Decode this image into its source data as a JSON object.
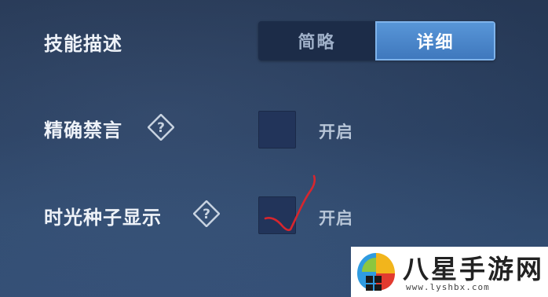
{
  "settings": {
    "skill_description": {
      "label": "技能描述",
      "options": [
        "简略",
        "详细"
      ],
      "selected": "详细"
    },
    "accurate_mute": {
      "label": "精确禁言",
      "has_help_icon": true,
      "checkbox_label": "开启",
      "checked": false
    },
    "time_seed_display": {
      "label": "时光种子显示",
      "has_help_icon": true,
      "checkbox_label": "开启",
      "checked": false
    }
  },
  "annotation": {
    "type": "hand-drawn-checkmark",
    "color": "#d7262e"
  },
  "watermark": {
    "title": "八星手游网",
    "url": "www.lyshbx.com"
  },
  "colors": {
    "background": "#2c4468",
    "segment_selected": "#4a86cc",
    "segment_unselected": "#1c2c48",
    "checkbox_fill": "#22345a"
  }
}
